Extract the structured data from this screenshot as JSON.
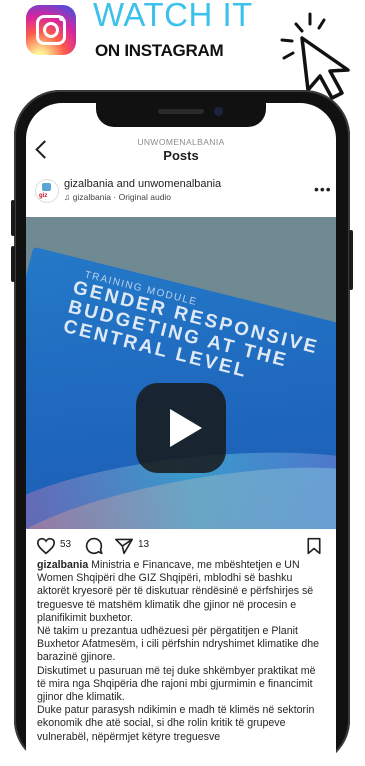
{
  "promo": {
    "watch_label": "WATCH IT",
    "sub_label": "ON INSTAGRAM",
    "accent_color": "#3cc1ea",
    "logo_icon": "instagram-icon",
    "cursor_icon": "click-cursor-icon"
  },
  "header": {
    "account": "UNWOMENALBANIA",
    "title": "Posts",
    "back_icon": "chevron-left-icon"
  },
  "post": {
    "authors": "gizalbania and unwomenalbania",
    "audio": "gizalbania · Original audio",
    "audio_icon": "music-note-icon",
    "more_icon": "more-horizontal-icon",
    "media": {
      "subtitle": "TRAINING MODULE",
      "title_lines": [
        "GENDER RESPONSIVE",
        "BUDGETING AT THE",
        "CENTRAL LEVEL"
      ],
      "play_icon": "play-icon"
    },
    "likes": "53",
    "shares": "13",
    "caption": {
      "username": "gizalbania",
      "p1": "Ministria e Financave, me mbështetjen e UN Women Shqipëri dhe GIZ Shqipëri, mblodhi së bashku aktorët kryesorë për të diskutuar rëndësinë e përfshirjes së treguesve të matshëm klimatik dhe gjinor në procesin e planifikimit buxhetor.",
      "p2": "Në takim u prezantua udhëzuesi për përgatitjen e Planit Buxhetor Afatmesëm, i cili përfshin ndryshimet klimatike dhe barazinë gjinore.",
      "p3": "Diskutimet u pasuruan më tej duke shkëmbyer praktikat më të mira nga Shqipëria dhe rajoni mbi gjurmimin e financimit gjinor dhe klimatik.",
      "p4": "Duke patur parasysh ndikimin e madh të klimës në sektorin ekonomik dhe atë social, si dhe rolin kritik të grupeve vulnerabël, nëpërmjet këtyre treguesve"
    }
  }
}
